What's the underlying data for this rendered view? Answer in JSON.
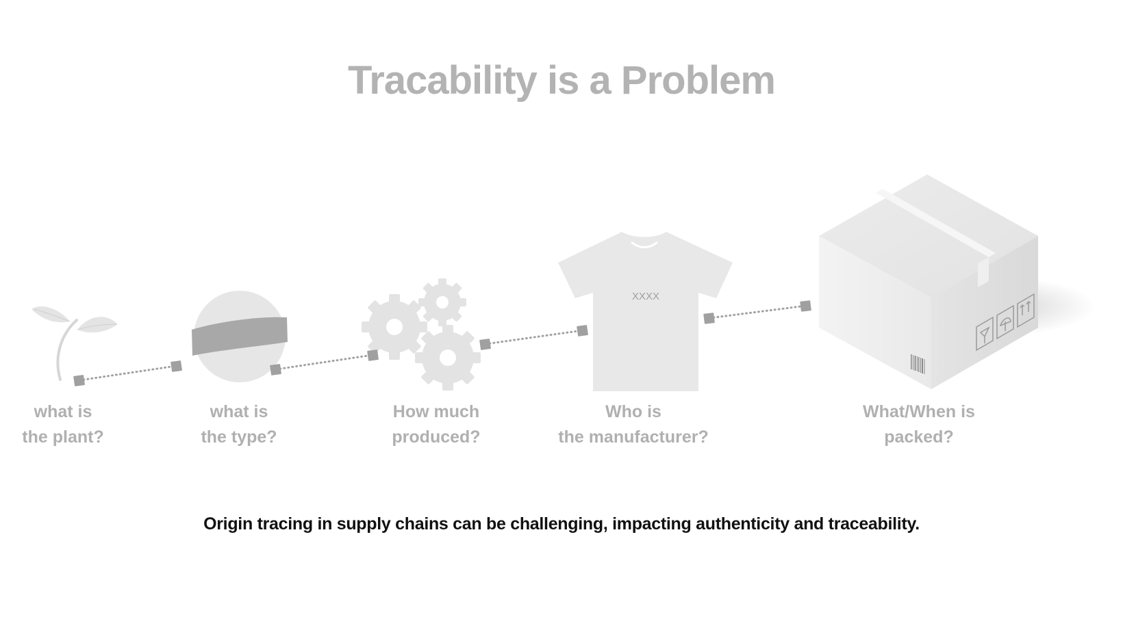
{
  "title": "Tracability is a Problem",
  "steps": [
    {
      "icon": "plant-icon",
      "line1": "what is",
      "line2": "the plant?"
    },
    {
      "icon": "yarn-ball-icon",
      "line1": "what is",
      "line2": "the type?"
    },
    {
      "icon": "gears-icon",
      "line1": "How much",
      "line2": "produced?"
    },
    {
      "icon": "tshirt-icon",
      "line1": "Who is",
      "line2": "the manufacturer?"
    },
    {
      "icon": "cardboard-box-icon",
      "line1": "What/When is",
      "line2": "packed?"
    }
  ],
  "tshirt_print": "XXXX",
  "caption": "Origin tracing in supply chains can be challenging, impacting authenticity and traceability.",
  "colors": {
    "title": "#b3b3b3",
    "label": "#b0b0b0",
    "icon_light": "#e6e6e6",
    "icon_dark": "#a6a6a6",
    "connector": "#a0a0a0",
    "caption": "#111111"
  }
}
